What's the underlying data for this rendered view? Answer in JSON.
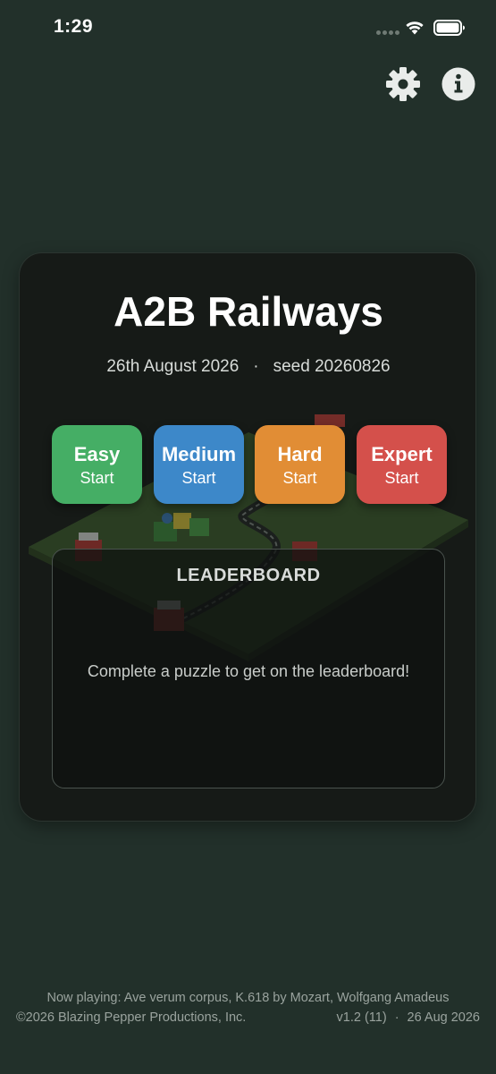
{
  "status_bar": {
    "time": "1:29"
  },
  "header": {
    "settings_icon": "gear-icon",
    "info_icon": "info-icon"
  },
  "card": {
    "title": "A2B Railways",
    "date": "26th August 2026",
    "separator": "·",
    "seed": "seed 20260826",
    "difficulties": [
      {
        "name": "Easy",
        "action": "Start",
        "color": "#45ae65"
      },
      {
        "name": "Medium",
        "action": "Start",
        "color": "#3d88c9"
      },
      {
        "name": "Hard",
        "action": "Start",
        "color": "#e18d35"
      },
      {
        "name": "Expert",
        "action": "Start",
        "color": "#d4504b"
      }
    ],
    "leaderboard": {
      "title": "LEADERBOARD",
      "empty_message": "Complete a puzzle to get on the leaderboard!"
    }
  },
  "footer": {
    "now_playing": "Now playing: Ave verum corpus, K.618 by Mozart, Wolfgang Amadeus",
    "copyright": "©2026 Blazing Pepper Productions, Inc.",
    "version": "v1.2 (11)",
    "separator": "·",
    "build_date": "26 Aug 2026"
  }
}
